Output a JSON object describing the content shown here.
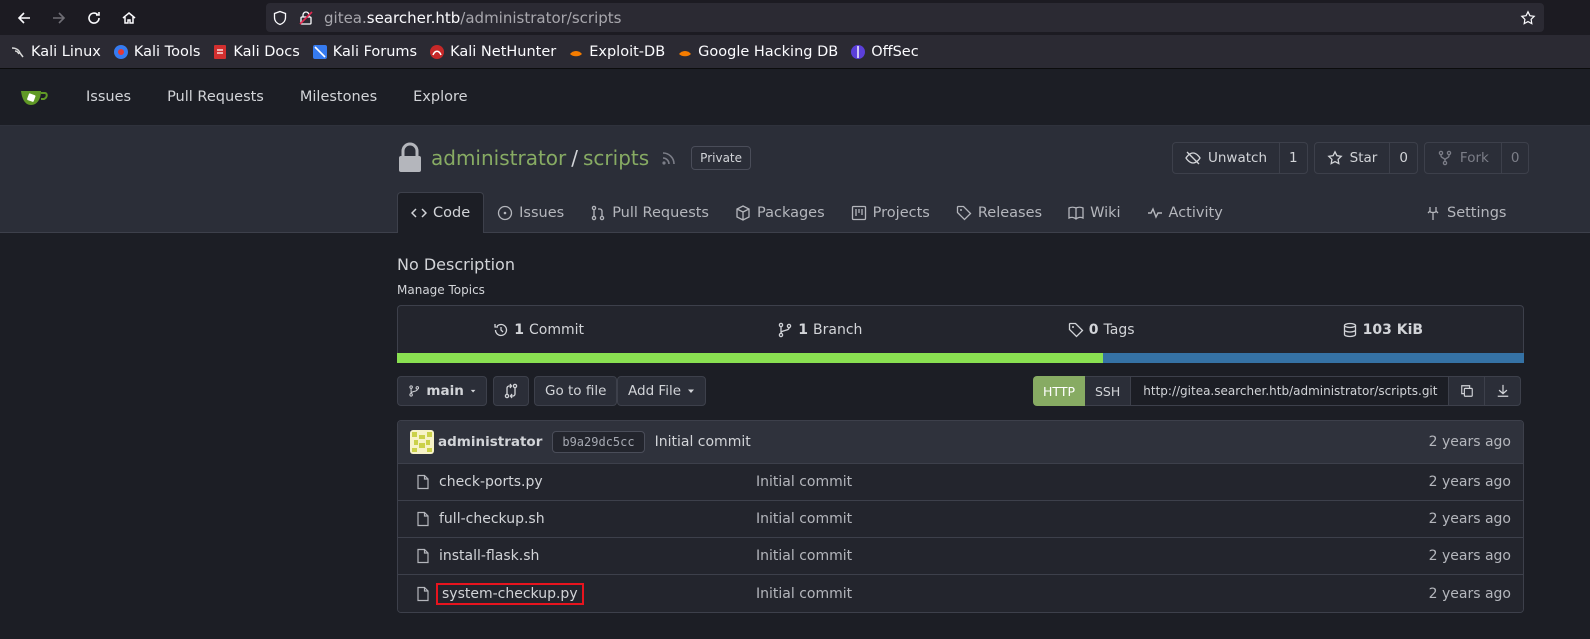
{
  "browser": {
    "url_prefix": "gitea.",
    "url_domain": "searcher.htb",
    "url_path": "/administrator/scripts",
    "bookmarks": [
      {
        "label": "Kali Linux",
        "icon": "kali-dragon-icon"
      },
      {
        "label": "Kali Tools",
        "icon": "kali-tools-icon"
      },
      {
        "label": "Kali Docs",
        "icon": "kali-docs-icon"
      },
      {
        "label": "Kali Forums",
        "icon": "kali-forums-icon"
      },
      {
        "label": "Kali NetHunter",
        "icon": "kali-nethunter-icon"
      },
      {
        "label": "Exploit-DB",
        "icon": "exploit-db-icon"
      },
      {
        "label": "Google Hacking DB",
        "icon": "ghdb-icon"
      },
      {
        "label": "OffSec",
        "icon": "offsec-icon"
      }
    ]
  },
  "nav": {
    "items": [
      "Issues",
      "Pull Requests",
      "Milestones",
      "Explore"
    ]
  },
  "repo": {
    "owner": "administrator",
    "name": "scripts",
    "visibility": "Private",
    "unwatch_label": "Unwatch",
    "watch_count": "1",
    "star_label": "Star",
    "star_count": "0",
    "fork_label": "Fork",
    "fork_count": "0",
    "tabs": [
      "Code",
      "Issues",
      "Pull Requests",
      "Packages",
      "Projects",
      "Releases",
      "Wiki",
      "Activity"
    ],
    "settings_label": "Settings",
    "description": "No Description",
    "manage_topics": "Manage Topics"
  },
  "stats": {
    "commits_num": "1",
    "commits_label": "Commit",
    "branches_num": "1",
    "branches_label": "Branch",
    "tags_num": "0",
    "tags_label": "Tags",
    "size": "103 KiB"
  },
  "language_bar": [
    {
      "color": "#89e051",
      "percent": 62.6
    },
    {
      "color": "#3572a5",
      "percent": 37.4
    }
  ],
  "toolbar": {
    "branch": "main",
    "goto_file": "Go to file",
    "add_file": "Add File",
    "clone_http": "HTTP",
    "clone_ssh": "SSH",
    "clone_url": "http://gitea.searcher.htb/administrator/scripts.git"
  },
  "latest_commit": {
    "author": "administrator",
    "sha": "b9a29dc5cc",
    "message": "Initial commit",
    "time": "2 years ago"
  },
  "files": [
    {
      "name": "check-ports.py",
      "message": "Initial commit",
      "time": "2 years ago"
    },
    {
      "name": "full-checkup.sh",
      "message": "Initial commit",
      "time": "2 years ago"
    },
    {
      "name": "install-flask.sh",
      "message": "Initial commit",
      "time": "2 years ago"
    },
    {
      "name": "system-checkup.py",
      "message": "Initial commit",
      "time": "2 years ago"
    }
  ],
  "colors": {
    "accent_green": "#87ab63",
    "highlight_box": "#e8141e"
  }
}
